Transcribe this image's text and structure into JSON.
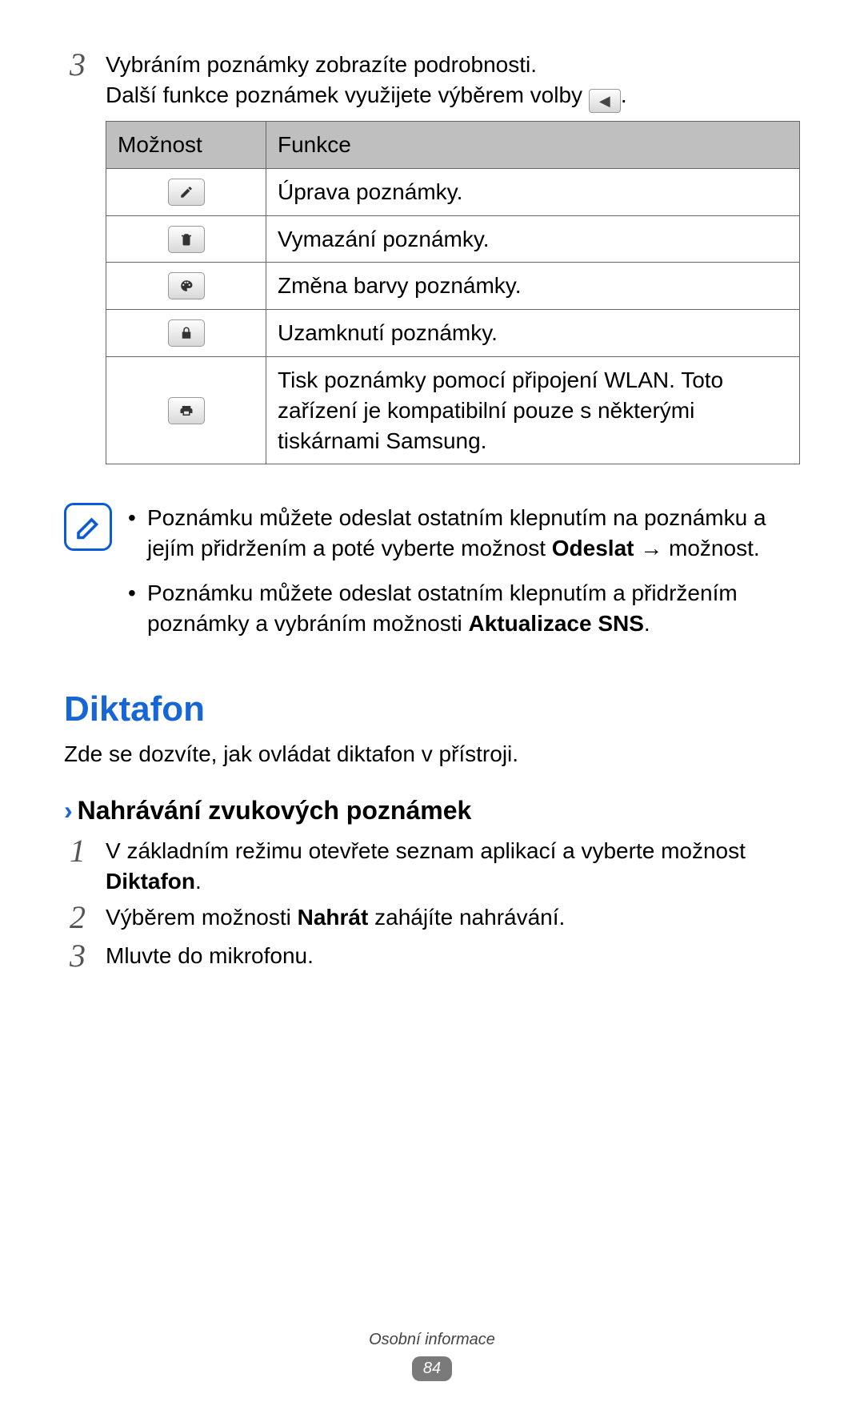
{
  "step3": {
    "num": "3",
    "line1": "Vybráním poznámky zobrazíte podrobnosti.",
    "line2_pre": "Další funkce poznámek využijete výběrem volby ",
    "line2_post": "."
  },
  "table": {
    "head_option": "Možnost",
    "head_func": "Funkce",
    "rows": [
      {
        "icon": "edit",
        "func": "Úprava poznámky."
      },
      {
        "icon": "trash",
        "func": "Vymazání poznámky."
      },
      {
        "icon": "palette",
        "func": "Změna barvy poznámky."
      },
      {
        "icon": "lock",
        "func": "Uzamknutí poznámky."
      },
      {
        "icon": "print",
        "func": "Tisk poznámky pomocí připojení WLAN. Toto zařízení je kompatibilní pouze s některými tiskárnami Samsung."
      }
    ]
  },
  "notes": {
    "b1_pre": "Poznámku můžete odeslat ostatním klepnutím na poznámku a jejím přidržením a poté vyberte možnost ",
    "b1_bold": "Odeslat",
    "b1_post": " → možnost.",
    "b2_pre": "Poznámku můžete odeslat ostatním klepnutím a přidržením poznámky a vybráním možnosti ",
    "b2_bold": "Aktualizace SNS",
    "b2_post": "."
  },
  "section": {
    "title": "Diktafon",
    "lead": "Zde se dozvíte, jak ovládat diktafon v přístroji."
  },
  "sub": {
    "title": "Nahrávání zvukových poznámek"
  },
  "rec": {
    "s1_num": "1",
    "s1_pre": "V základním režimu otevřete seznam aplikací a vyberte možnost ",
    "s1_bold": "Diktafon",
    "s1_post": ".",
    "s2_num": "2",
    "s2_pre": "Výběrem možnosti ",
    "s2_bold": "Nahrát",
    "s2_post": " zahájíte nahrávání.",
    "s3_num": "3",
    "s3_text": "Mluvte do mikrofonu."
  },
  "footer": {
    "category": "Osobní informace",
    "page": "84"
  },
  "icons": {
    "left_triangle": "◀"
  }
}
